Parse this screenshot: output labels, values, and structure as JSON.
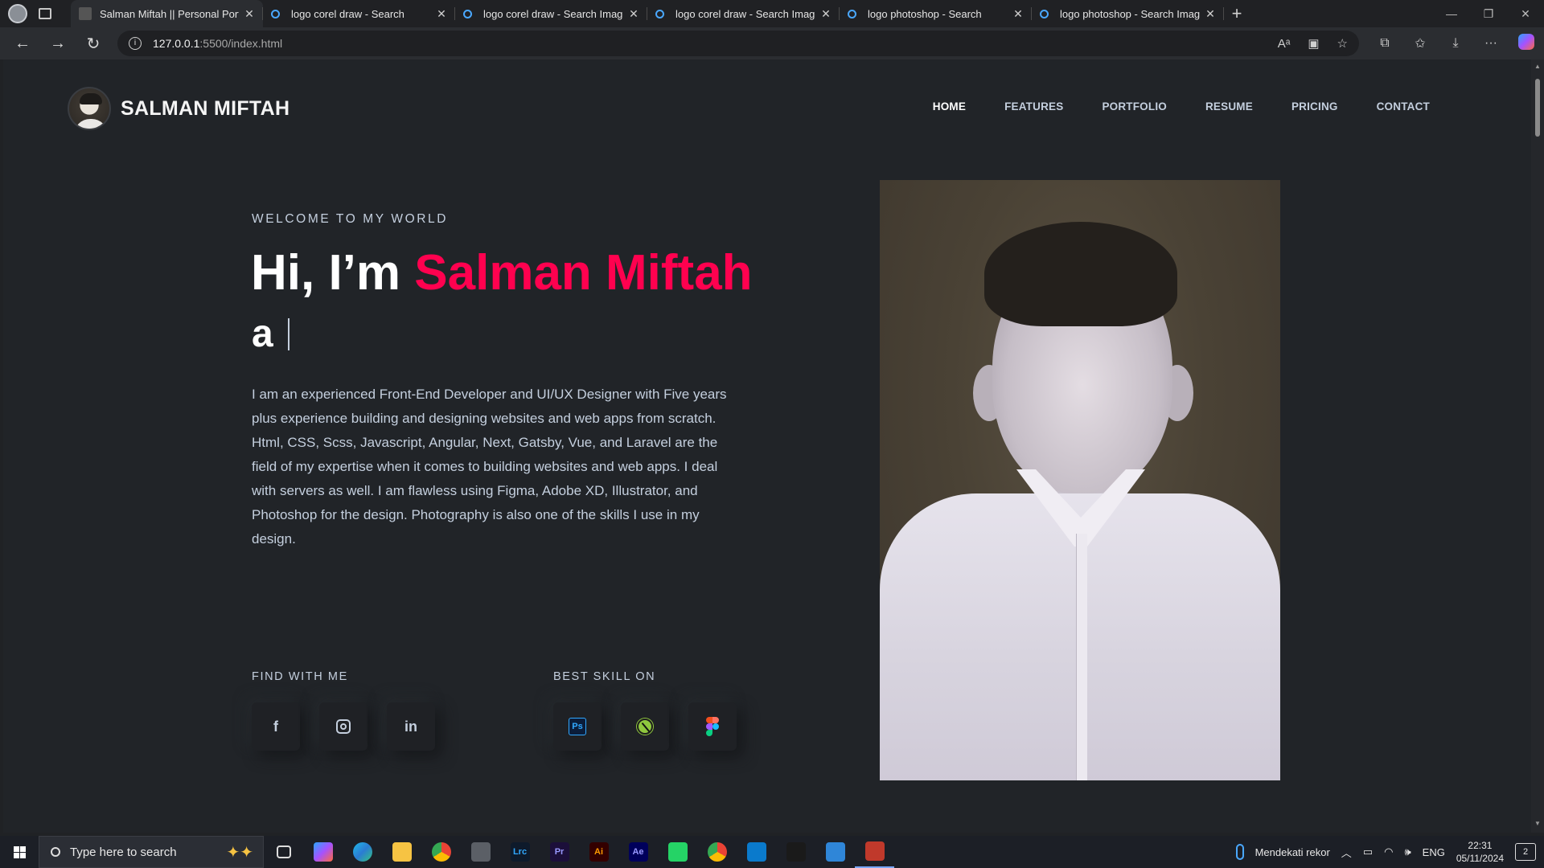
{
  "browser": {
    "tabs": [
      {
        "title": "Salman Miftah || Personal Portfolio",
        "active": true,
        "favicon": "site-icon"
      },
      {
        "title": "logo corel draw - Search",
        "active": false,
        "favicon": "search-icon"
      },
      {
        "title": "logo corel draw - Search Images",
        "active": false,
        "favicon": "search-icon"
      },
      {
        "title": "logo corel draw - Search Images",
        "active": false,
        "favicon": "search-icon"
      },
      {
        "title": "logo photoshop - Search",
        "active": false,
        "favicon": "search-icon"
      },
      {
        "title": "logo photoshop - Search Images",
        "active": false,
        "favicon": "search-icon"
      }
    ],
    "url_host": "127.0.0.1",
    "url_rest": ":5500/index.html"
  },
  "site": {
    "name": "SALMAN MIFTAH",
    "nav": [
      "HOME",
      "FEATURES",
      "PORTFOLIO",
      "RESUME",
      "PRICING",
      "CONTACT"
    ],
    "nav_active": "HOME",
    "accent_color": "#ff014f"
  },
  "hero": {
    "eyebrow": "WELCOME TO MY WORLD",
    "greeting": "Hi, I’m ",
    "name": "Salman Miftah",
    "typed_prefix": "a",
    "bio": "I am an experienced Front-End Developer and UI/UX Designer with Five years plus experience building and designing websites and web apps from scratch. Html, CSS, Scss, Javascript, Angular, Next, Gatsby, Vue, and Laravel are the field of my expertise when it comes to building websites and web apps. I deal with servers as well. I am flawless using Figma, Adobe XD, Illustrator, and Photoshop for the design. Photography is also one of the skills I use in my design.",
    "find_label": "FIND WITH ME",
    "skill_label": "BEST SKILL ON",
    "social": [
      "facebook-icon",
      "instagram-icon",
      "linkedin-icon"
    ],
    "skills": [
      "photoshop-icon",
      "coreldraw-icon",
      "figma-icon"
    ],
    "ps_text": "Ps",
    "fb_text": "f",
    "li_text": "in"
  },
  "taskbar": {
    "search_placeholder": "Type here to search",
    "apps": [
      {
        "name": "task-view-icon",
        "label": "",
        "color": "#ffffff",
        "bg": "transparent"
      },
      {
        "name": "copilot-app-icon",
        "label": "",
        "color": "#ffffff",
        "bg": "linear-gradient(135deg,#2aa6ff,#a552ff,#ff6a3d)"
      },
      {
        "name": "edge-icon",
        "label": "",
        "color": "#ffffff",
        "bg": "linear-gradient(135deg,#1fb9e8,#2b7cd3,#33c481)"
      },
      {
        "name": "file-explorer-icon",
        "label": "",
        "color": "#ffffff",
        "bg": "#f6c343"
      },
      {
        "name": "chrome-icon",
        "label": "",
        "color": "#ffffff",
        "bg": "conic-gradient(#ea4335 0 33%,#fbbc04 0 66%,#34a853 0)"
      },
      {
        "name": "calculator-icon",
        "label": "",
        "color": "#ffffff",
        "bg": "#5b5f66"
      },
      {
        "name": "lightroom-classic-icon",
        "label": "Lrc",
        "color": "#31a8ff",
        "bg": "#0e1a2b"
      },
      {
        "name": "premiere-icon",
        "label": "Pr",
        "color": "#9999ff",
        "bg": "#1c0f3a"
      },
      {
        "name": "illustrator-icon",
        "label": "Ai",
        "color": "#ff9a00",
        "bg": "#330000"
      },
      {
        "name": "after-effects-icon",
        "label": "Ae",
        "color": "#9999ff",
        "bg": "#00005b"
      },
      {
        "name": "whatsapp-icon",
        "label": "",
        "color": "#ffffff",
        "bg": "#25d366"
      },
      {
        "name": "chrome-profile-icon",
        "label": "",
        "color": "#ffffff",
        "bg": "conic-gradient(#ea4335 0 33%,#fbbc04 0 66%,#34a853 0)"
      },
      {
        "name": "vscode-icon",
        "label": "",
        "color": "#ffffff",
        "bg": "#0a7acc"
      },
      {
        "name": "coreldraw-app-icon",
        "label": "",
        "color": "#ffffff",
        "bg": "#1a1a1a"
      },
      {
        "name": "photos-icon",
        "label": "",
        "color": "#ffffff",
        "bg": "#2f86d8"
      },
      {
        "name": "app-running-icon",
        "label": "",
        "color": "#ffffff",
        "bg": "#c0392b"
      }
    ],
    "weather_text": "Mendekati rekor",
    "lang": "ENG",
    "time": "22:31",
    "date": "05/11/2024",
    "notif_count": "2"
  }
}
